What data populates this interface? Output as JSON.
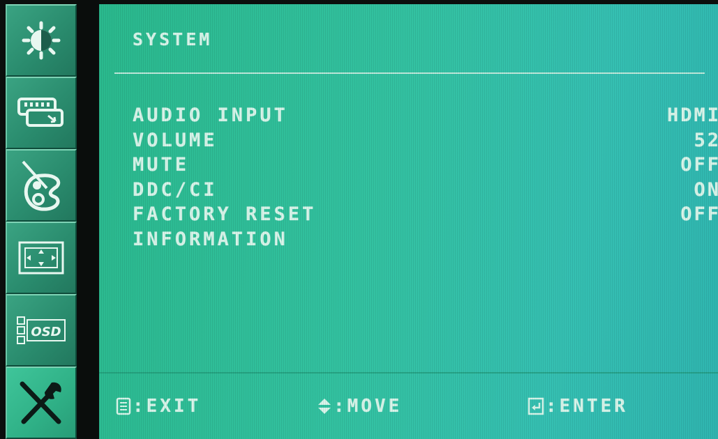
{
  "colors": {
    "panel_bg": "#2fbf9c",
    "tab_bg": "#2a8c6e",
    "tab_active_bg": "#2fb086",
    "text": "#d8f5ea"
  },
  "sidebar": {
    "tabs": [
      {
        "icon": "brightness-contrast-icon",
        "active": false
      },
      {
        "icon": "input-source-icon",
        "active": false
      },
      {
        "icon": "color-palette-icon",
        "active": false
      },
      {
        "icon": "image-position-icon",
        "active": false
      },
      {
        "icon": "osd-settings-icon",
        "active": false,
        "label": "OSD"
      },
      {
        "icon": "tools-icon",
        "active": true
      }
    ]
  },
  "main": {
    "title": "SYSTEM",
    "items": [
      {
        "label": "AUDIO INPUT",
        "value": "HDMI"
      },
      {
        "label": "VOLUME",
        "value": "52"
      },
      {
        "label": "MUTE",
        "value": "OFF"
      },
      {
        "label": "DDC/CI",
        "value": "ON"
      },
      {
        "label": "FACTORY RESET",
        "value": "OFF"
      },
      {
        "label": "INFORMATION",
        "value": ""
      }
    ]
  },
  "footer": {
    "exit": {
      "icon": "menu-icon",
      "label": ":EXIT"
    },
    "move": {
      "icon": "up-down-arrows-icon",
      "label": ":MOVE"
    },
    "enter": {
      "icon": "enter-icon",
      "label": ":ENTER"
    }
  }
}
